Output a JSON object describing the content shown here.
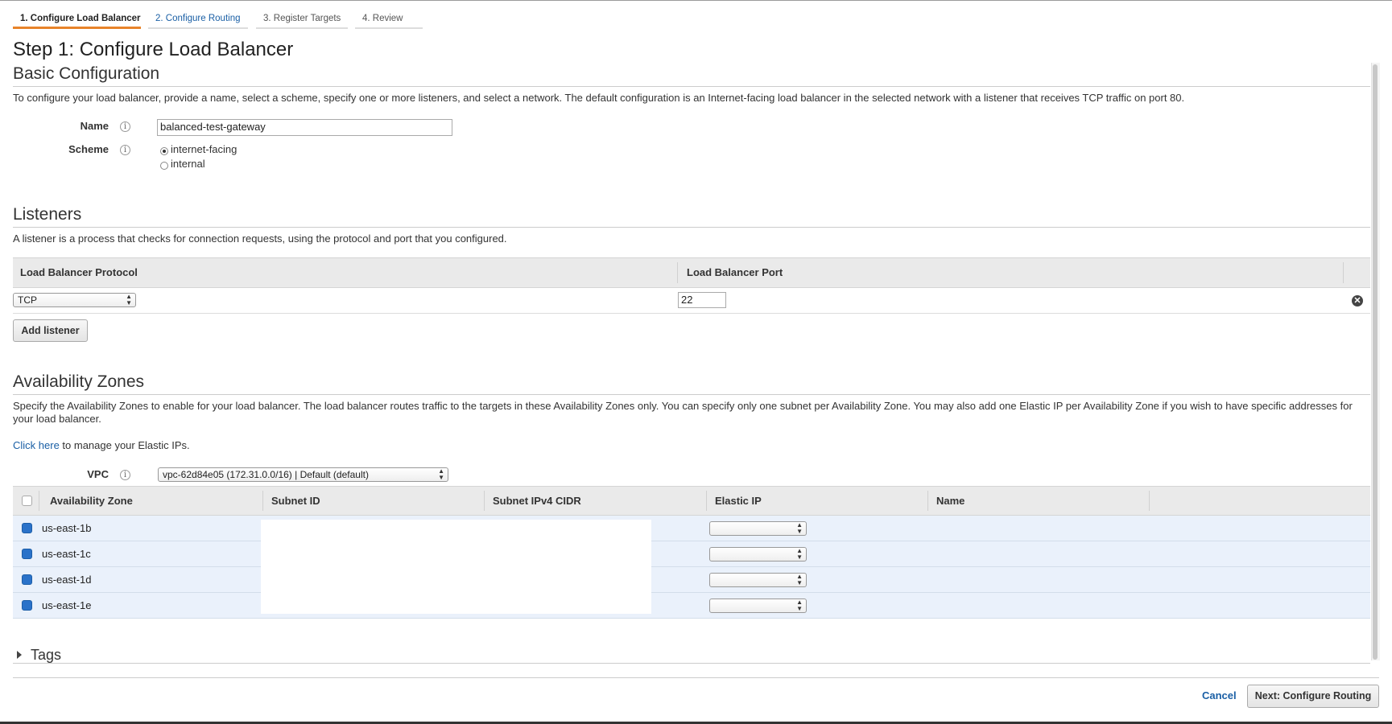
{
  "tabs": [
    {
      "label": "1. Configure Load Balancer"
    },
    {
      "label": "2. Configure Routing"
    },
    {
      "label": "3. Register Targets"
    },
    {
      "label": "4. Review"
    }
  ],
  "page_title": "Step 1: Configure Load Balancer",
  "basic": {
    "heading": "Basic Configuration",
    "description": "To configure your load balancer, provide a name, select a scheme, specify one or more listeners, and select a network. The default configuration is an Internet-facing load balancer in the selected network with a listener that receives TCP traffic on port 80.",
    "name_label": "Name",
    "name_value": "balanced-test-gateway",
    "scheme_label": "Scheme",
    "scheme_options": [
      "internet-facing",
      "internal"
    ],
    "scheme_selected": "internet-facing"
  },
  "listeners": {
    "heading": "Listeners",
    "description": "A listener is a process that checks for connection requests, using the protocol and port that you configured.",
    "col_protocol": "Load Balancer Protocol",
    "col_port": "Load Balancer Port",
    "protocol_value": "TCP",
    "port_value": "22",
    "add_button": "Add listener"
  },
  "az": {
    "heading": "Availability Zones",
    "description": "Specify the Availability Zones to enable for your load balancer. The load balancer routes traffic to the targets in these Availability Zones only. You can specify only one subnet per Availability Zone. You may also add one Elastic IP per Availability Zone if you wish to have specific addresses for your load balancer.",
    "click_here": "Click here",
    "manage_text": " to manage your Elastic IPs.",
    "vpc_label": "VPC",
    "vpc_value": "vpc-62d84e05 (172.31.0.0/16) | Default (default)",
    "columns": [
      "Availability Zone",
      "Subnet ID",
      "Subnet IPv4 CIDR",
      "Elastic IP",
      "Name"
    ],
    "zones": [
      {
        "name": "us-east-1b",
        "checked": true
      },
      {
        "name": "us-east-1c",
        "checked": true
      },
      {
        "name": "us-east-1d",
        "checked": true
      },
      {
        "name": "us-east-1e",
        "checked": true
      }
    ]
  },
  "tags": {
    "label": "Tags"
  },
  "footer": {
    "cancel": "Cancel",
    "next": "Next: Configure Routing"
  }
}
